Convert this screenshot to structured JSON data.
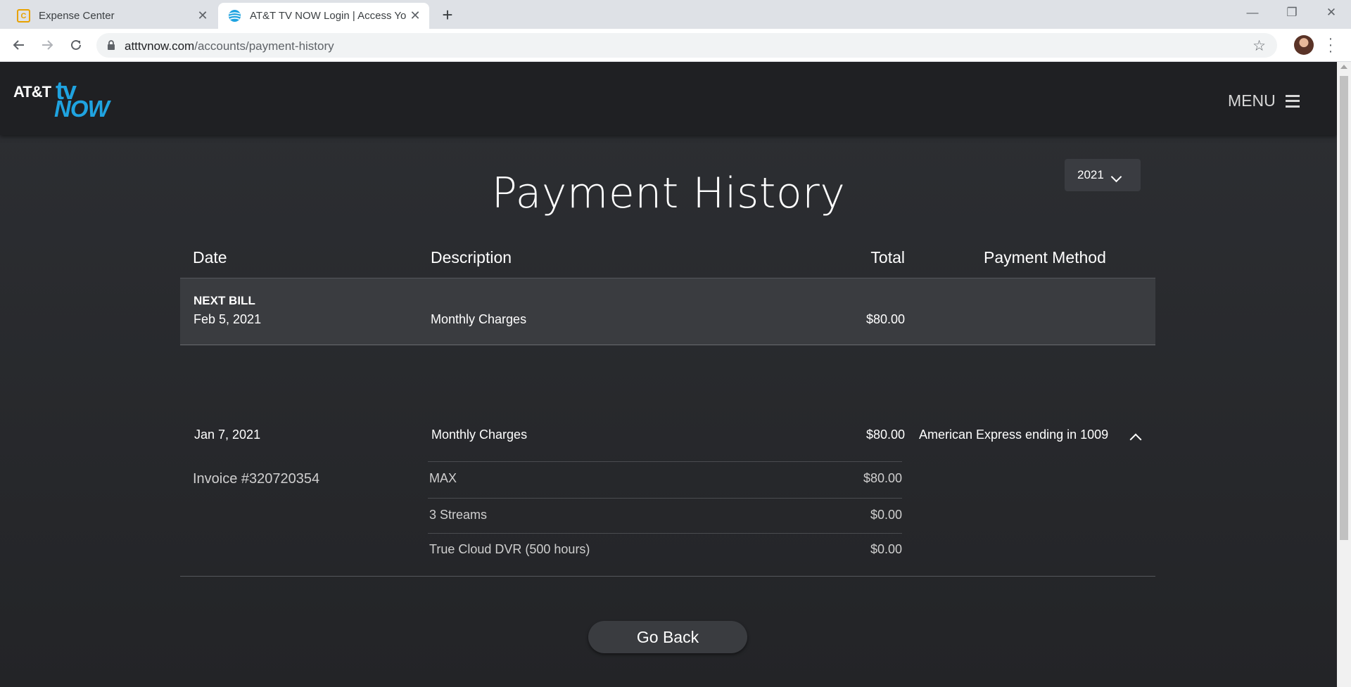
{
  "browser": {
    "tabs": [
      {
        "title": "Expense Center",
        "favicon": "expense-center-icon"
      },
      {
        "title": "AT&T TV NOW Login | Access Your",
        "favicon": "att-globe-icon"
      }
    ],
    "new_tab": "+",
    "url_host": "atttvnow.com",
    "url_path": "/accounts/payment-history"
  },
  "header": {
    "logo_att": "AT&T",
    "logo_tv": "tv",
    "logo_now": "NOW",
    "menu_label": "MENU"
  },
  "page": {
    "title": "Payment History",
    "year_selected": "2021"
  },
  "table": {
    "headers": {
      "date": "Date",
      "description": "Description",
      "total": "Total",
      "payment_method": "Payment Method"
    },
    "next_bill": {
      "label": "NEXT BILL",
      "date": "Feb 5, 2021",
      "description": "Monthly Charges",
      "total": "$80.00"
    },
    "payment": {
      "date": "Jan 7, 2021",
      "description": "Monthly Charges",
      "total": "$80.00",
      "method": "American Express ending in 1009",
      "invoice": "Invoice #320720354",
      "items": [
        {
          "name": "MAX",
          "amount": "$80.00"
        },
        {
          "name": "3 Streams",
          "amount": "$0.00"
        },
        {
          "name": "True Cloud DVR (500 hours)",
          "amount": "$0.00"
        }
      ]
    }
  },
  "actions": {
    "go_back": "Go Back"
  },
  "colors": {
    "brand_blue": "#1fa3e0",
    "page_bg": "#2b2d31",
    "row_highlight": "#3a3c40"
  }
}
